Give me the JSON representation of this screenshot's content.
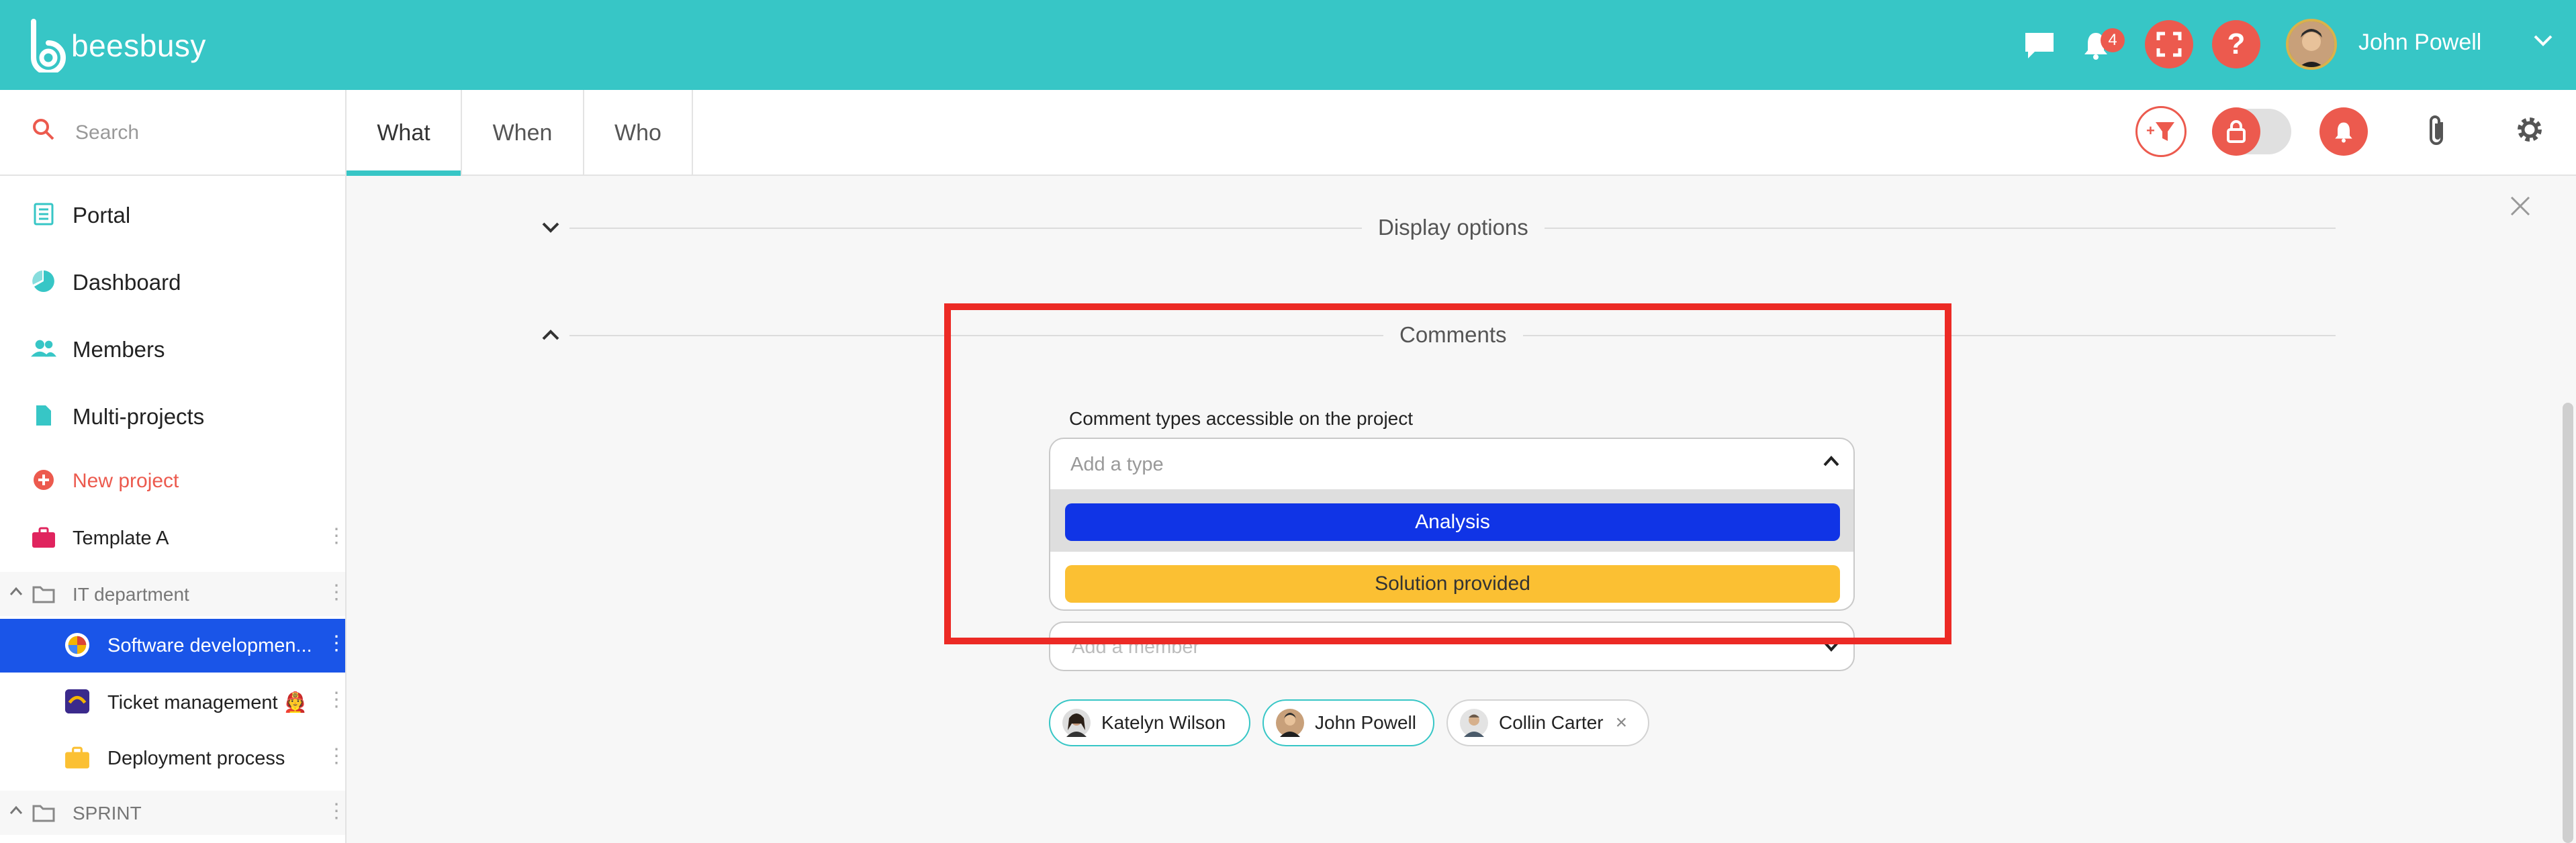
{
  "app": {
    "logo_text": "beesbusy",
    "notifications_count": "4",
    "user_name": "John Powell",
    "accent": "#37c6c6",
    "danger": "#ec5a4e"
  },
  "search": {
    "placeholder": "Search"
  },
  "tabs": [
    {
      "label": "What",
      "active": true
    },
    {
      "label": "When",
      "active": false
    },
    {
      "label": "Who",
      "active": false
    }
  ],
  "sidebar": {
    "items": [
      {
        "label": "Portal",
        "icon": "portal-icon"
      },
      {
        "label": "Dashboard",
        "icon": "pie-chart-icon"
      },
      {
        "label": "Members",
        "icon": "members-icon"
      },
      {
        "label": "Multi-projects",
        "icon": "document-icon"
      },
      {
        "label": "New project",
        "icon": "plus-circle-icon"
      },
      {
        "label": "Template A",
        "icon": "briefcase-icon"
      },
      {
        "label": "IT department",
        "icon": "folder-icon"
      },
      {
        "label": "Software developmen...",
        "icon": "project-avatar-icon",
        "selected": true
      },
      {
        "label": "Ticket management 🧑‍🚒",
        "icon": "project-avatar-icon"
      },
      {
        "label": "Deployment process",
        "icon": "briefcase-icon"
      },
      {
        "label": "SPRINT",
        "icon": "folder-icon"
      }
    ]
  },
  "main": {
    "display_options_title": "Display options",
    "comments_title": "Comments",
    "comment_types_label": "Comment types accessible on the project",
    "type_placeholder": "Add a type",
    "type_options": [
      {
        "label": "Analysis",
        "color": "#1034e6",
        "text_color": "#ffffff"
      },
      {
        "label": "Solution provided",
        "color": "#fbc033",
        "text_color": "#333333"
      }
    ],
    "member_placeholder": "Add a member",
    "members": [
      {
        "name": "Katelyn Wilson",
        "removable": false
      },
      {
        "name": "John Powell",
        "removable": false
      },
      {
        "name": "Collin Carter",
        "removable": true
      }
    ],
    "remove_glyph": "×"
  }
}
